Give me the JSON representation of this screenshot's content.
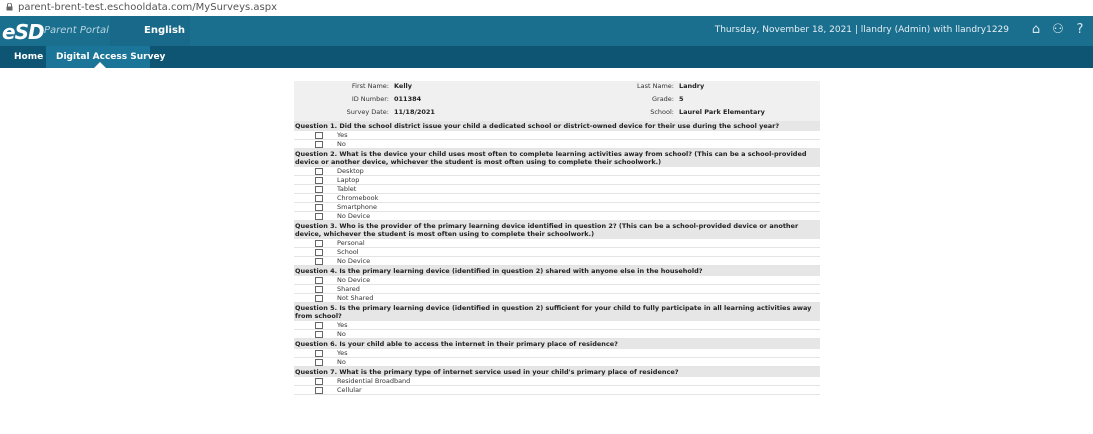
{
  "browser": {
    "url": "parent-brent-test.eschooldata.com/MySurveys.aspx"
  },
  "header": {
    "logo": "eSD",
    "portal": "Parent Portal",
    "language": "English",
    "status": "Thursday, November 18, 2021  |  llandry (Admin) with llandry1229",
    "icons": [
      "home-icon",
      "user-icon",
      "help-icon"
    ]
  },
  "nav": {
    "home": "Home",
    "active": "Digital Access Survey"
  },
  "student": {
    "first_name_label": "First Name:",
    "first_name": "Kelly",
    "last_name_label": "Last Name:",
    "last_name": "Landry",
    "id_label": "ID Number:",
    "id": "011384",
    "grade_label": "Grade:",
    "grade": "5",
    "date_label": "Survey Date:",
    "date": "11/18/2021",
    "school_label": "School:",
    "school": "Laurel Park Elementary"
  },
  "questions": [
    {
      "text": "Question 1. Did the school district issue your child a dedicated school or district-owned device for their use during the school year?",
      "options": [
        "Yes",
        "No"
      ]
    },
    {
      "text": "Question 2. What is the device your child uses most often to complete learning activities away from school? (This can be a school-provided device or another device, whichever the student is most often using to complete their schoolwork.)",
      "options": [
        "Desktop",
        "Laptop",
        "Tablet",
        "Chromebook",
        "Smartphone",
        "No Device"
      ]
    },
    {
      "text": "Question 3. Who is the provider of the primary learning device identified in question 2? (This can be a school-provided device or another device, whichever the student is most often using to complete their schoolwork.)",
      "options": [
        "Personal",
        "School",
        "No Device"
      ]
    },
    {
      "text": "Question 4. Is the primary learning device (identified in question 2) shared with anyone else in the household?",
      "options": [
        "No Device",
        "Shared",
        "Not Shared"
      ]
    },
    {
      "text": "Question 5. Is the primary learning device (identified in question 2) sufficient for your child to fully participate in all learning activities away from school?",
      "options": [
        "Yes",
        "No"
      ]
    },
    {
      "text": "Question 6. Is your child able to access the internet in their primary place of residence?",
      "options": [
        "Yes",
        "No"
      ]
    },
    {
      "text": "Question 7. What is the primary type of internet service used in your child's primary place of residence?",
      "options": [
        "Residential Broadband",
        "Cellular"
      ]
    }
  ]
}
